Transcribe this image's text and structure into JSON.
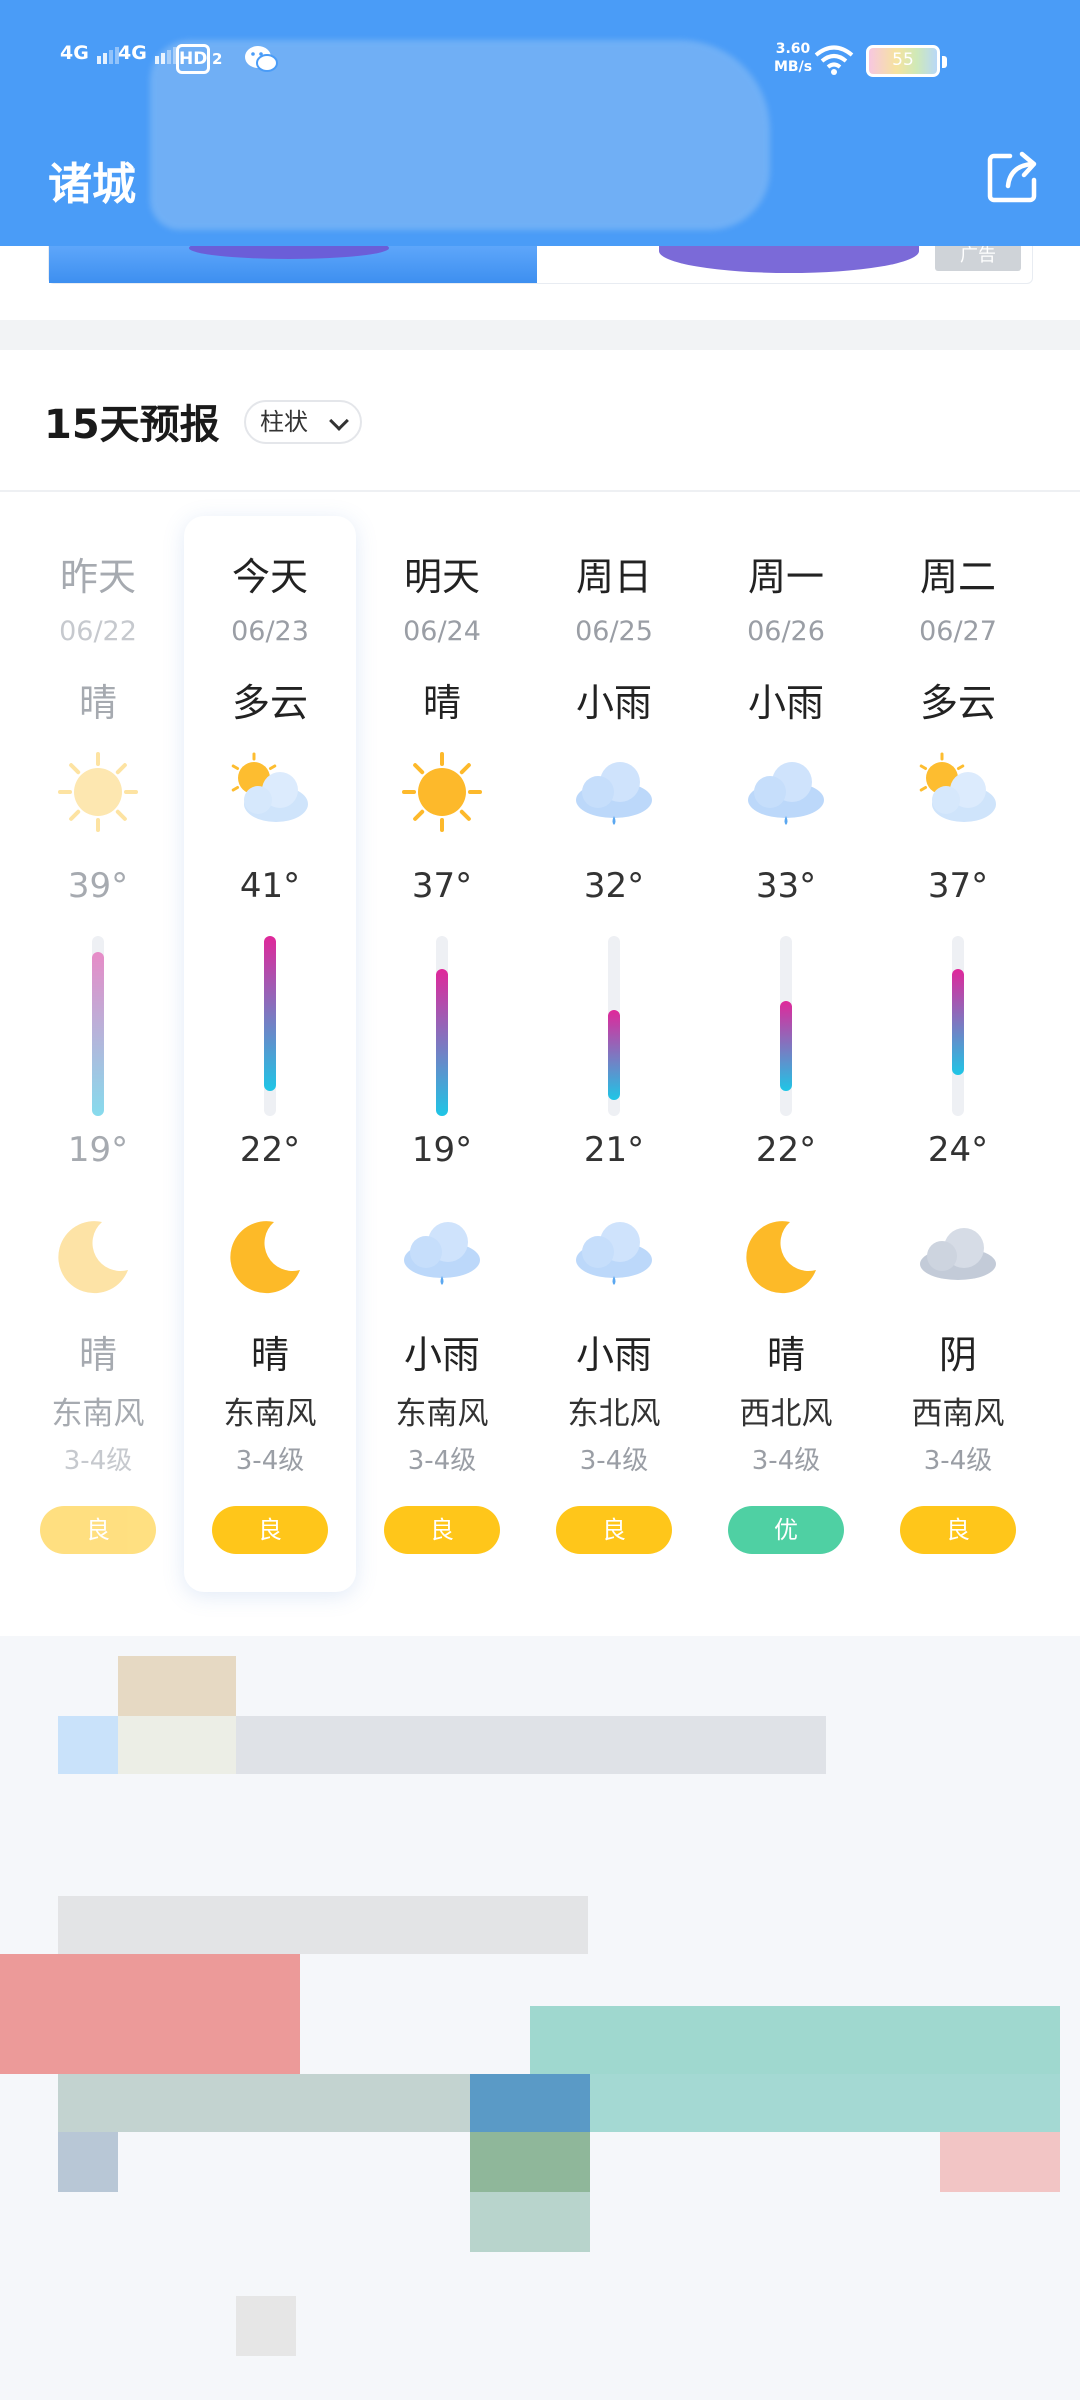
{
  "status_bar": {
    "signal_1": "4G",
    "signal_2": "4G",
    "hd": "HD",
    "hd_sub": "2",
    "speed_value": "3.60",
    "speed_unit": "MB/s",
    "battery": "55"
  },
  "header": {
    "city": "诸城"
  },
  "ad": {
    "tag": "广告"
  },
  "forecast": {
    "title": "15天预报",
    "mode_label": "柱状",
    "days": [
      {
        "day": "昨天",
        "date": "06/22",
        "weather": "晴",
        "day_icon": "sun-icon",
        "high": "39°",
        "high_value": 39,
        "low": "19°",
        "low_value": 19,
        "night_icon": "moon-icon",
        "night_weather": "晴",
        "wind": "东南风",
        "level": "3-4级",
        "aqi": "良",
        "aqi_color": "#ffc61a"
      },
      {
        "day": "今天",
        "date": "06/23",
        "weather": "多云",
        "day_icon": "partly-cloudy-icon",
        "high": "41°",
        "high_value": 41,
        "low": "22°",
        "low_value": 22,
        "night_icon": "moon-icon",
        "night_weather": "晴",
        "wind": "东南风",
        "level": "3-4级",
        "aqi": "良",
        "aqi_color": "#ffc61a"
      },
      {
        "day": "明天",
        "date": "06/24",
        "weather": "晴",
        "day_icon": "sun-icon",
        "high": "37°",
        "high_value": 37,
        "low": "19°",
        "low_value": 19,
        "night_icon": "rain-cloud-icon",
        "night_weather": "小雨",
        "wind": "东南风",
        "level": "3-4级",
        "aqi": "良",
        "aqi_color": "#ffc61a"
      },
      {
        "day": "周日",
        "date": "06/25",
        "weather": "小雨",
        "day_icon": "rain-cloud-icon",
        "high": "32°",
        "high_value": 32,
        "low": "21°",
        "low_value": 21,
        "night_icon": "rain-cloud-icon",
        "night_weather": "小雨",
        "wind": "东北风",
        "level": "3-4级",
        "aqi": "良",
        "aqi_color": "#ffc61a"
      },
      {
        "day": "周一",
        "date": "06/26",
        "weather": "小雨",
        "day_icon": "rain-cloud-icon",
        "high": "33°",
        "high_value": 33,
        "low": "22°",
        "low_value": 22,
        "night_icon": "moon-icon",
        "night_weather": "晴",
        "wind": "西北风",
        "level": "3-4级",
        "aqi": "优",
        "aqi_color": "#4fd0a3"
      },
      {
        "day": "周二",
        "date": "06/27",
        "weather": "多云",
        "day_icon": "partly-cloudy-icon",
        "high": "37°",
        "high_value": 37,
        "low": "24°",
        "low_value": 24,
        "night_icon": "overcast-cloud-icon",
        "night_weather": "阴",
        "wind": "西南风",
        "level": "3-4级",
        "aqi": "良",
        "aqi_color": "#ffc61a"
      }
    ]
  },
  "colors": {
    "header_bg": "#4a9cf7",
    "temp_bar_top": "#e0279a",
    "temp_bar_bottom": "#1ec6e6",
    "aqi_good": "#ffc61a",
    "aqi_excellent": "#4fd0a3"
  }
}
